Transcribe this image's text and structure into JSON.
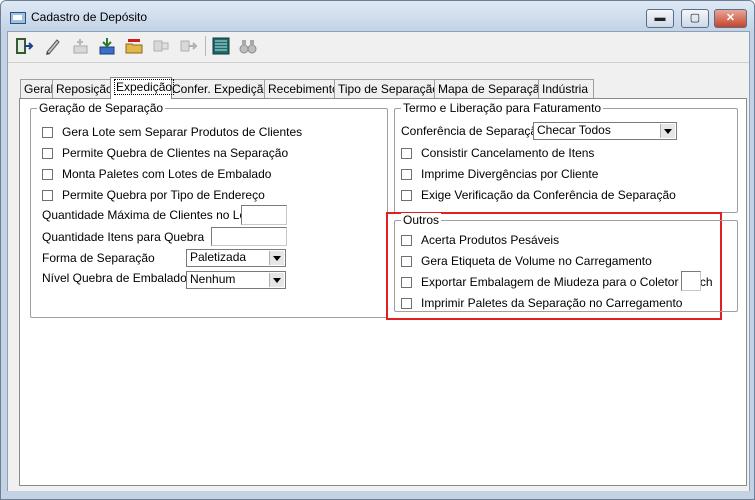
{
  "window": {
    "title": "Cadastro de Depósito",
    "min": "▬",
    "max": "▢",
    "close": "✕"
  },
  "toolbar": [
    {
      "name": "exit-icon"
    },
    {
      "name": "edit-icon"
    },
    {
      "name": "add-icon"
    },
    {
      "name": "save-icon"
    },
    {
      "name": "open-icon"
    },
    {
      "name": "cancel-icon"
    },
    {
      "name": "forward-icon"
    },
    {
      "name": "report-icon"
    },
    {
      "name": "binoculars-icon"
    }
  ],
  "tabs": [
    "Geral",
    "Reposição",
    "Expedição",
    "Confer. Expedição",
    "Recebimento",
    "Tipo de Separação",
    "Mapa de Separação",
    "Indústria"
  ],
  "active_tab": "Expedição",
  "geracao": {
    "legend": "Geração de Separação",
    "checks": [
      "Gera Lote sem Separar Produtos de Clientes",
      "Permite Quebra de Clientes na Separação",
      "Monta Paletes com Lotes de Embalado",
      "Permite Quebra por Tipo de Endereço"
    ],
    "qtd_max_label": "Quantidade Máxima de Clientes no Lote",
    "qtd_max_value": "",
    "qtd_itens_label": "Quantidade Itens para Quebra",
    "qtd_itens_value": "",
    "forma_label": "Forma de Separação",
    "forma_value": "Paletizada",
    "nivel_label": "Nível Quebra de Embalados",
    "nivel_value": "Nenhum"
  },
  "termo": {
    "legend": "Termo e Liberação para Faturamento",
    "conferencia_label": "Conferência de Separação",
    "conferencia_value": "Checar Todos",
    "checks": [
      "Consistir Cancelamento de Itens",
      "Imprime Divergências por Cliente",
      "Exige Verificação da Conferência de Separação"
    ]
  },
  "outros": {
    "legend": "Outros",
    "checks": [
      "Acerta Produtos Pesáveis",
      "Gera Etiqueta de Volume no Carregamento",
      "Exportar Embalagem de Miudeza para o Coletor Batch",
      "Imprimir Paletes da Separação no Carregamento"
    ],
    "coletor_value": ""
  },
  "colors": {
    "highlight": "#e02020",
    "title_bg": "#c4d3e4"
  }
}
